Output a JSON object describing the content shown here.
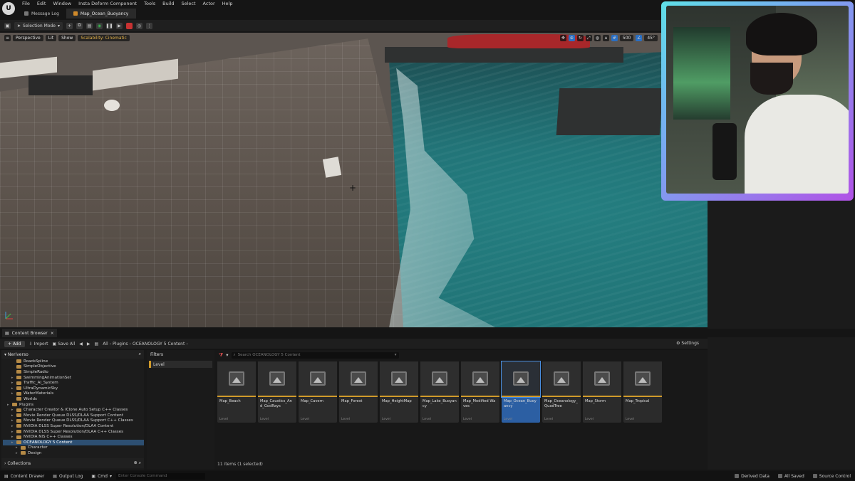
{
  "menu": {
    "items": [
      "File",
      "Edit",
      "Window",
      "Insta Deform Component",
      "Tools",
      "Build",
      "Select",
      "Actor",
      "Help"
    ]
  },
  "tabs": [
    {
      "label": "Message Log"
    },
    {
      "label": "Map_Ocean_Buoyancy"
    }
  ],
  "toolbar": {
    "selection_mode": "Selection Mode"
  },
  "viewport": {
    "perspective": "Perspective",
    "lit": "Lit",
    "show": "Show",
    "scalability": "Scalability: Cinematic",
    "grid_size": "500",
    "angle": "45°"
  },
  "content_browser": {
    "tab_label": "Content Browser",
    "add": "Add",
    "import": "Import",
    "save_all": "Save All",
    "breadcrumb": [
      "All",
      "Plugins",
      "OCEANOLOGY 5 Content"
    ],
    "settings": "Settings",
    "sources_root": "Neriverso",
    "tree": [
      {
        "label": "RoadsSpline",
        "indent": 2,
        "caret": false
      },
      {
        "label": "SimpleObjective",
        "indent": 2,
        "caret": false
      },
      {
        "label": "SimpleRadio",
        "indent": 2,
        "caret": false
      },
      {
        "label": "SwimmingAnimationSet",
        "indent": 2,
        "caret": true
      },
      {
        "label": "Traffic_AI_System",
        "indent": 2,
        "caret": true
      },
      {
        "label": "UltraDynamicSky",
        "indent": 2,
        "caret": true
      },
      {
        "label": "WaterMaterials",
        "indent": 2,
        "caret": true
      },
      {
        "label": "Worlds",
        "indent": 2,
        "caret": false
      },
      {
        "label": "Plugins",
        "indent": 1,
        "caret": true
      },
      {
        "label": "Character Creator & iClone Auto Setup C++ Classes",
        "indent": 2,
        "caret": true
      },
      {
        "label": "Movie Render Queue DLSS/DLAA Support Content",
        "indent": 2,
        "caret": true
      },
      {
        "label": "Movie Render Queue DLSS/DLAA Support C++ Classes",
        "indent": 2,
        "caret": true
      },
      {
        "label": "NVIDIA DLSS Super Resolution/DLAA Content",
        "indent": 2,
        "caret": true
      },
      {
        "label": "NVIDIA DLSS Super Resolution/DLAA C++ Classes",
        "indent": 2,
        "caret": true
      },
      {
        "label": "NVIDIA NIS C++ Classes",
        "indent": 2,
        "caret": true
      },
      {
        "label": "OCEANOLOGY 5 Content",
        "indent": 2,
        "caret": true,
        "selected": true
      },
      {
        "label": "Character",
        "indent": 3,
        "caret": true
      },
      {
        "label": "Design",
        "indent": 3,
        "caret": true
      }
    ],
    "collections": "Collections",
    "filters_title": "Filters",
    "filter_chip": "Level",
    "search_placeholder": "Search OCEANOLOGY 5 Content",
    "assets": [
      {
        "name": "Map_Beach",
        "type": "Level"
      },
      {
        "name": "Map_Caustics_And_GodRays",
        "type": "Level"
      },
      {
        "name": "Map_Cavern",
        "type": "Level"
      },
      {
        "name": "Map_Forest",
        "type": "Level"
      },
      {
        "name": "Map_HeightMap",
        "type": "Level"
      },
      {
        "name": "Map_Lake_Buoyancy",
        "type": "Level"
      },
      {
        "name": "Map_Modified Waves",
        "type": "Level"
      },
      {
        "name": "Map_Ocean_Buoyancy",
        "type": "Level",
        "selected": true
      },
      {
        "name": "Map_Oceanology_QuadTree",
        "type": "Level"
      },
      {
        "name": "Map_Storm",
        "type": "Level"
      },
      {
        "name": "Map_Tropical",
        "type": "Level"
      }
    ],
    "items_count": "11 items (1 selected)"
  },
  "statusbar": {
    "content_drawer": "Content Drawer",
    "output_log": "Output Log",
    "cmd": "Cmd",
    "console_placeholder": "Enter Console Command",
    "derived_data": "Derived Data",
    "all_saved": "All Saved",
    "source_control": "Source Control"
  }
}
